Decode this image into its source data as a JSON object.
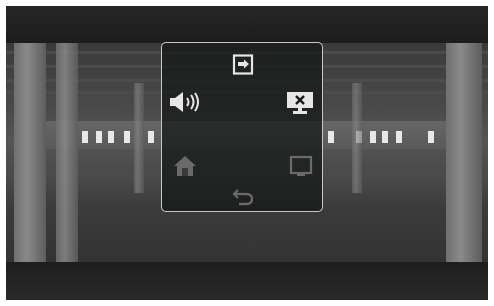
{
  "menu": {
    "items": [
      {
        "id": "input",
        "icon": "input-source-icon",
        "state": "active"
      },
      {
        "id": "volume",
        "icon": "speaker-volume-icon",
        "state": "active"
      },
      {
        "id": "screen-off",
        "icon": "screen-off-icon",
        "state": "active"
      },
      {
        "id": "home",
        "icon": "home-icon",
        "state": "dimmed"
      },
      {
        "id": "picture",
        "icon": "picture-icon",
        "state": "dimmed"
      },
      {
        "id": "back",
        "icon": "back-icon",
        "state": "dimmed"
      }
    ]
  },
  "colors": {
    "menu_border": "#c8c8c8",
    "icon_active": "#e6e6e6",
    "icon_dimmed": "#6a6a6a"
  }
}
